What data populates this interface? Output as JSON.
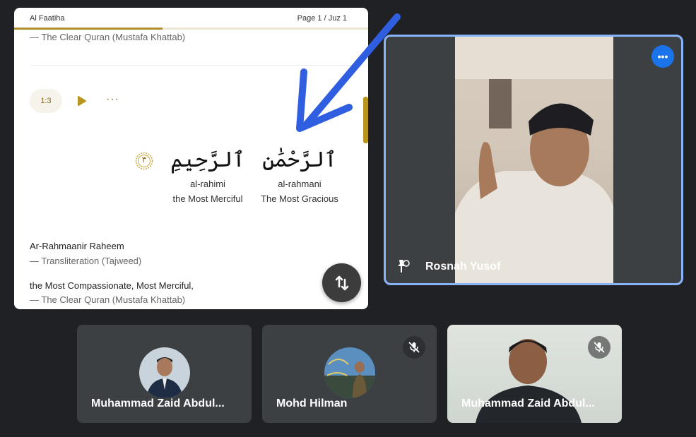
{
  "quran": {
    "surah": "Al Faatiha",
    "page_info": "Page 1 / Juz 1",
    "prev_translation_source": "— The Clear Quran (Mustafa Khattab)",
    "verse_badge": "1:3",
    "more": "···",
    "words": [
      {
        "arabic": "ٱلرَّحِيمِ",
        "translit": "al-rahimi",
        "english": "the Most Merciful"
      },
      {
        "arabic": "ٱلرَّحْمَٰنِ",
        "translit": "al-rahmani",
        "english": "The Most Gracious"
      }
    ],
    "verse_number": "٣",
    "transliteration": "Ar-Rahmaanir Raheem",
    "transliteration_source": "— Transliteration (Tajweed)",
    "translation": "the Most Compassionate, Most Merciful,",
    "translation_source": "— The Clear Quran (Mustafa Khattab)"
  },
  "speaker": {
    "name": "Rosnah Yusof",
    "menu": "•••"
  },
  "participants": [
    {
      "name": "Muhammad Zaid Abdul..."
    },
    {
      "name": "Mohd Hilman"
    },
    {
      "name": "Muhammad Zaid Abdul..."
    }
  ],
  "colors": {
    "accent_gold": "#b08f2a",
    "active_border": "#8ab4f8",
    "tile_bg": "#3c4043",
    "app_bg": "#202124",
    "annotation_arrow": "#2f5fe0"
  }
}
